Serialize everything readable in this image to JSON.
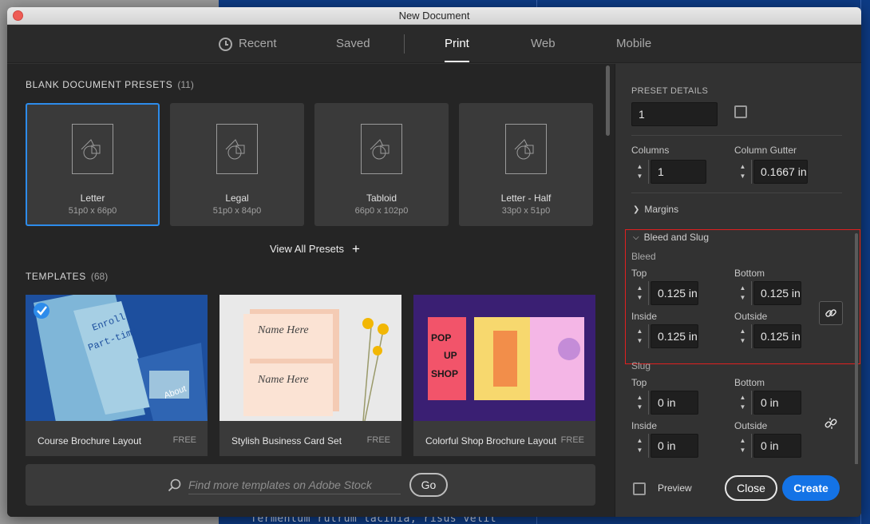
{
  "window": {
    "title": "New Document"
  },
  "tabs": [
    {
      "label": "Recent"
    },
    {
      "label": "Saved"
    },
    {
      "label": "Print"
    },
    {
      "label": "Web"
    },
    {
      "label": "Mobile"
    }
  ],
  "presets": {
    "title": "BLANK DOCUMENT PRESETS",
    "count": "(11)",
    "items": [
      {
        "name": "Letter",
        "size": "51p0 x 66p0"
      },
      {
        "name": "Legal",
        "size": "51p0 x 84p0"
      },
      {
        "name": "Tabloid",
        "size": "66p0 x 102p0"
      },
      {
        "name": "Letter - Half",
        "size": "33p0 x 51p0"
      }
    ],
    "view_all": "View All Presets"
  },
  "templates": {
    "title": "TEMPLATES",
    "count": "(68)",
    "items": [
      {
        "name": "Course Brochure Layout",
        "price": "FREE"
      },
      {
        "name": "Stylish Business Card Set",
        "price": "FREE"
      },
      {
        "name": "Colorful Shop Brochure Layout",
        "price": "FREE"
      }
    ]
  },
  "search": {
    "placeholder": "Find more templates on Adobe Stock",
    "go_label": "Go"
  },
  "details": {
    "header": "PRESET DETAILS",
    "pages_value": "1",
    "columns_label": "Columns",
    "columns_value": "1",
    "gutter_label": "Column Gutter",
    "gutter_value": "0.1667 in",
    "margins_label": "Margins",
    "bleed_slug_label": "Bleed and Slug",
    "bleed": {
      "label": "Bleed",
      "top_label": "Top",
      "top": "0.125 in",
      "bottom_label": "Bottom",
      "bottom": "0.125 in",
      "inside_label": "Inside",
      "inside": "0.125 in",
      "outside_label": "Outside",
      "outside": "0.125 in"
    },
    "slug": {
      "label": "Slug",
      "top_label": "Top",
      "top": "0 in",
      "bottom_label": "Bottom",
      "bottom": "0 in",
      "inside_label": "Inside",
      "inside": "0 in",
      "outside_label": "Outside",
      "outside": "0 in"
    }
  },
  "footer": {
    "preview_label": "Preview",
    "close_label": "Close",
    "create_label": "Create"
  },
  "backdrop_text": "fermentum rutrum lacinia, risus velit",
  "colors": {
    "accent": "#1473e6",
    "selection": "#2d8ceb",
    "highlight": "#e02020"
  }
}
